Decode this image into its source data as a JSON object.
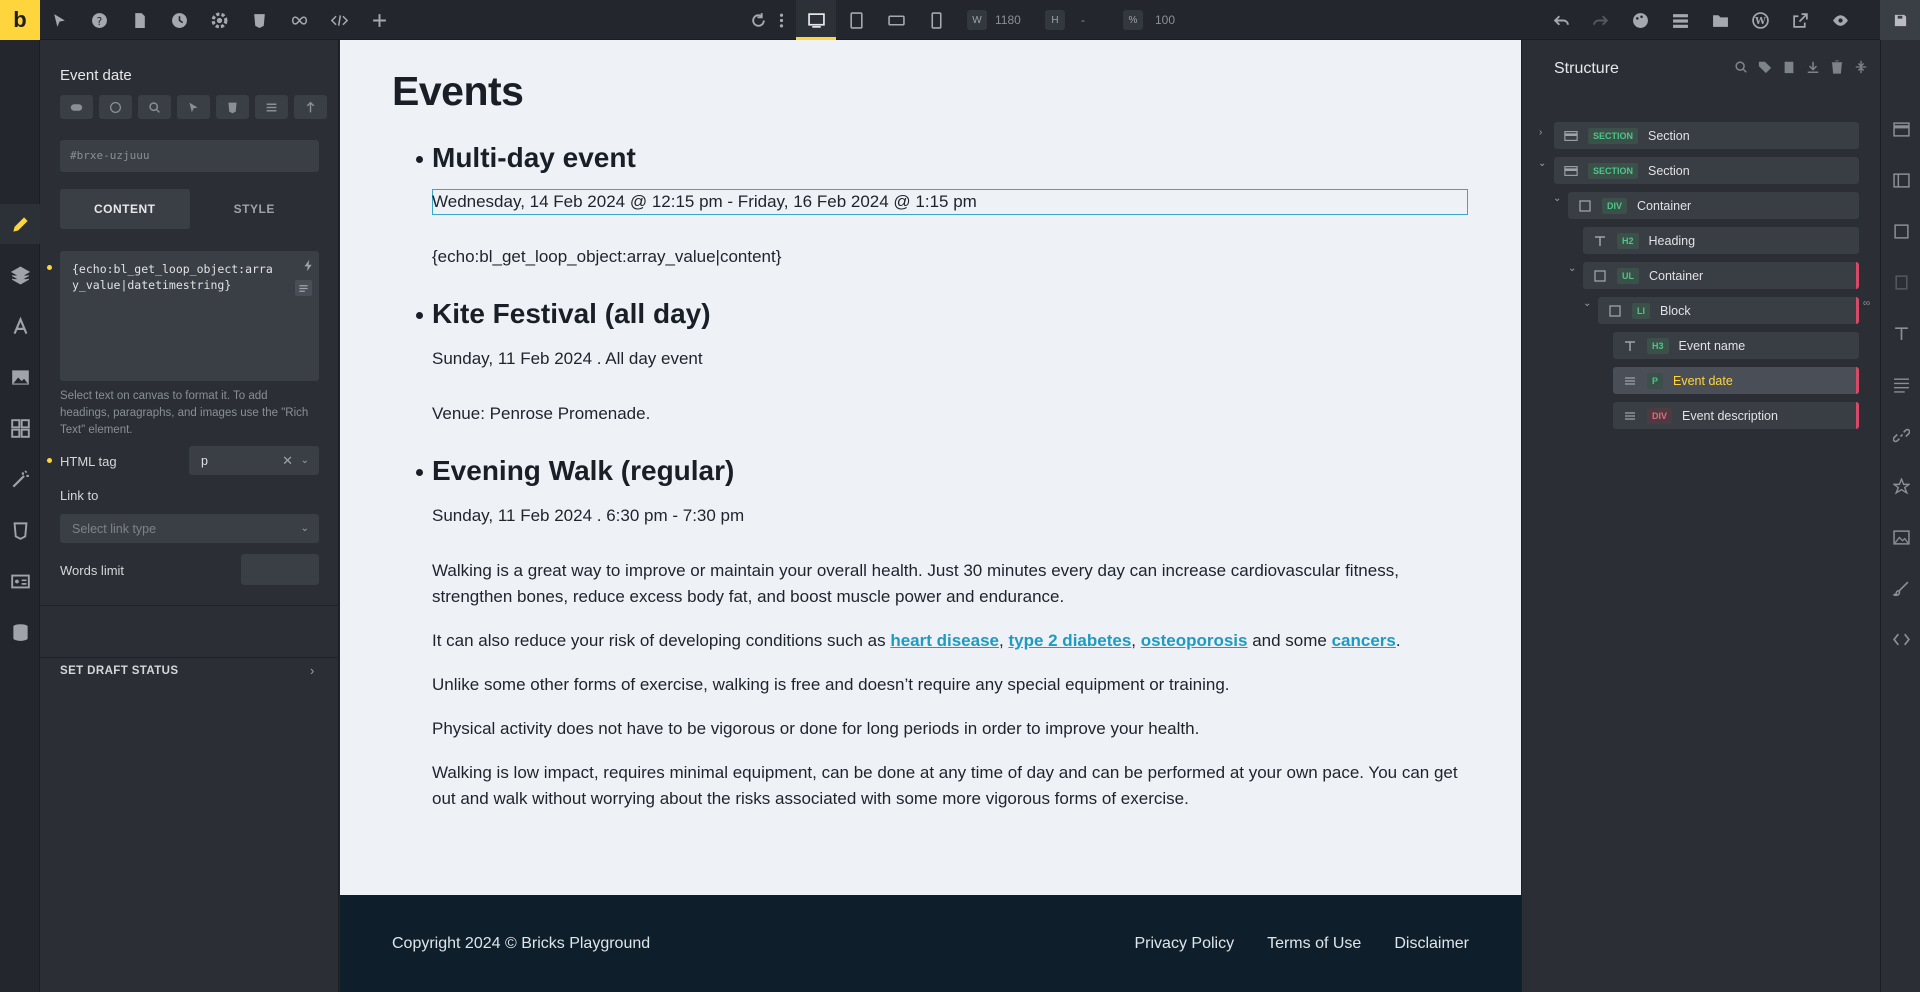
{
  "topbar": {
    "logo": "b",
    "width_label": "W",
    "width_value": "1180",
    "height_label": "H",
    "height_value": "-",
    "scale_label": "%",
    "scale_value": "100"
  },
  "panel": {
    "title": "Event date",
    "id_value": "#brxe-uzjuuu",
    "tabs": [
      "CONTENT",
      "STYLE"
    ],
    "text_value": "{echo:bl_get_loop_object:array_value|datetimestring}",
    "hint": "Select text on canvas to format it. To add headings, paragraphs, and images use the \"Rich Text\" element.",
    "html_tag_label": "HTML tag",
    "html_tag_value": "p",
    "link_to_label": "Link to",
    "link_type_placeholder": "Select link type",
    "words_limit_label": "Words limit",
    "draft_status": "SET DRAFT STATUS"
  },
  "canvas": {
    "title": "Events",
    "events": [
      {
        "name": "Multi-day event",
        "date": "Wednesday, 14 Feb 2024 @ 12:15 pm - Friday, 16 Feb 2024 @ 1:15 pm",
        "desc": "{echo:bl_get_loop_object:array_value|content}"
      },
      {
        "name": "Kite Festival (all day)",
        "date": "Sunday, 11 Feb 2024 . All day event",
        "desc": "Venue: Penrose Promenade."
      },
      {
        "name": "Evening Walk (regular)",
        "date": "Sunday, 11 Feb 2024 . 6:30 pm - 7:30 pm"
      }
    ],
    "walk_paragraphs": {
      "p1": "Walking is a great way to improve or maintain your overall health. Just 30 minutes every day can increase cardiovascular fitness, strengthen bones, reduce excess body fat, and boost muscle power and endurance.",
      "p2_start": "It can also reduce your risk of developing conditions such as ",
      "link1": "heart disease",
      "sep1": ", ",
      "link2": "type 2 diabetes",
      "sep2": ", ",
      "link3": "osteoporosis",
      "mid": " and some ",
      "link4": "cancers",
      "end": ".",
      "p3": "Unlike some other forms of exercise, walking is free and doesn’t require any special equipment or training.",
      "p4": "Physical activity does not have to be vigorous or done for long periods in order to improve your health.",
      "p5": "Walking is low impact, requires minimal equipment, can be done at any time of day and can be performed at your own pace. You can get out and walk without worrying about the risks associated with some more vigorous forms of exercise."
    },
    "footer": {
      "copyright": "Copyright 2024 © Bricks Playground",
      "links": [
        "Privacy Policy",
        "Terms of Use",
        "Disclaimer"
      ]
    }
  },
  "structure": {
    "title": "Structure",
    "rows": [
      {
        "tag": "SECTION",
        "label": "Section"
      },
      {
        "tag": "SECTION",
        "label": "Section"
      },
      {
        "tag": "DIV",
        "label": "Container"
      },
      {
        "tag": "H2",
        "label": "Heading"
      },
      {
        "tag": "UL",
        "label": "Container"
      },
      {
        "tag": "LI",
        "label": "Block"
      },
      {
        "tag": "H3",
        "label": "Event name"
      },
      {
        "tag": "P",
        "label": "Event date"
      },
      {
        "tag": "DIV",
        "label": "Event description"
      }
    ]
  },
  "colors": {
    "accent": "#ffd53e",
    "link": "#1f9ac0",
    "footer_bg": "#0e1f2b",
    "tag_green": "#4ec58b",
    "tag_red": "#e46a7e"
  }
}
